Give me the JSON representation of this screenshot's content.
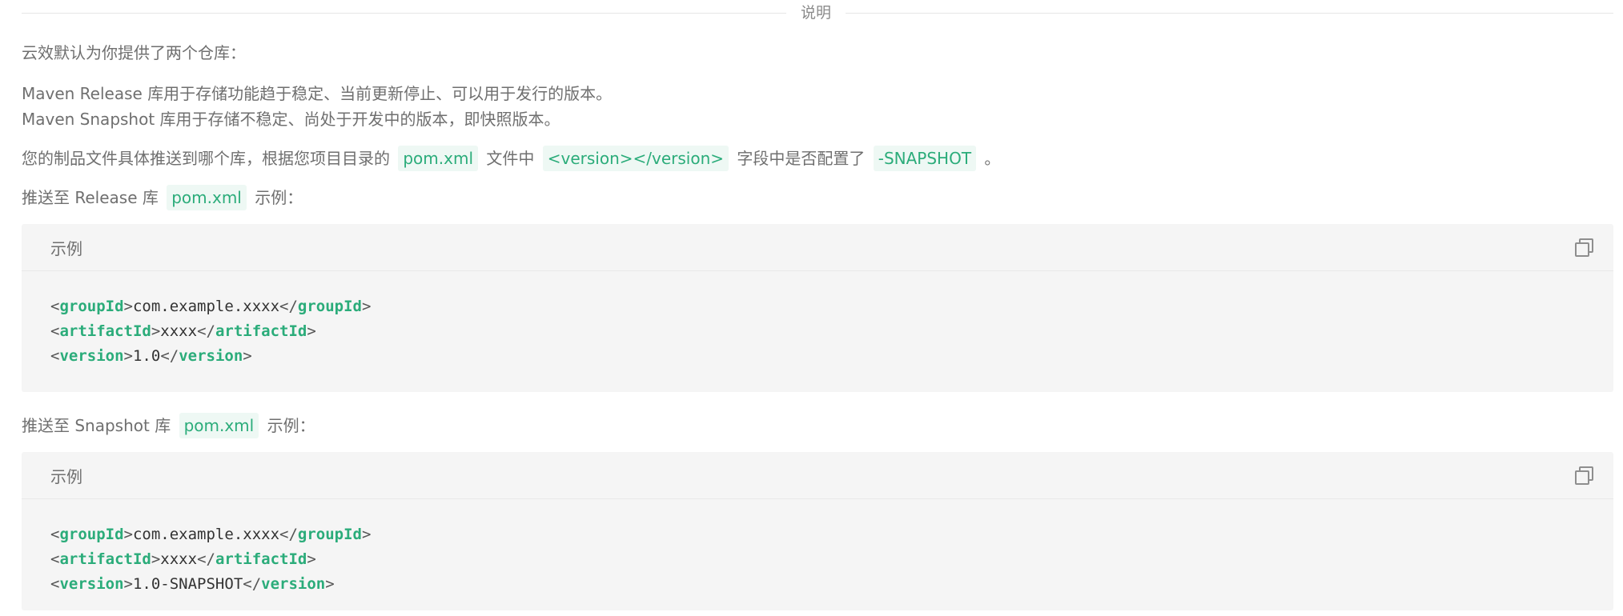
{
  "divider": {
    "title": "说明"
  },
  "intro": "云效默认为你提供了两个仓库：",
  "release_desc": "Maven Release 库用于存储功能趋于稳定、当前更新停止、可以用于发行的版本。",
  "snapshot_desc": "Maven Snapshot 库用于存储不稳定、尚处于开发中的版本，即快照版本。",
  "push_rule": {
    "part1": "您的制品文件具体推送到哪个库，根据您项目目录的",
    "code1": "pom.xml",
    "part2": "文件中",
    "code2": "<version></version>",
    "part3": "字段中是否配置了",
    "code3": "-SNAPSHOT",
    "part4": "。"
  },
  "release_section": {
    "heading_prefix": "推送至 Release 库",
    "heading_code": "pom.xml",
    "heading_suffix": "示例：",
    "example_label": "示例",
    "lines": [
      {
        "tag": "groupId",
        "value": "com.example.xxxx"
      },
      {
        "tag": "artifactId",
        "value": "xxxx"
      },
      {
        "tag": "version",
        "value": "1.0"
      }
    ]
  },
  "snapshot_section": {
    "heading_prefix": "推送至 Snapshot 库",
    "heading_code": "pom.xml",
    "heading_suffix": "示例：",
    "example_label": "示例",
    "lines": [
      {
        "tag": "groupId",
        "value": "com.example.xxxx"
      },
      {
        "tag": "artifactId",
        "value": "xxxx"
      },
      {
        "tag": "version",
        "value": "1.0-SNAPSHOT"
      }
    ]
  },
  "colors": {
    "accent": "#2bac7a",
    "inline_code_bg": "#eef8f4",
    "text": "#6f6f6f",
    "code_bg": "#f5f5f5"
  },
  "icons": {
    "copy": "copy-icon"
  }
}
